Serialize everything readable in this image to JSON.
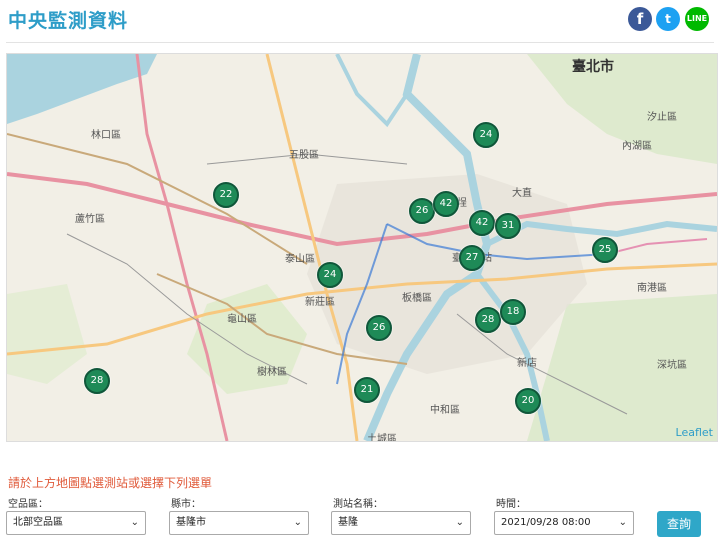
{
  "header": {
    "title": "中央監測資料",
    "social": {
      "facebook": "f",
      "twitter": "t",
      "line": "LINE"
    }
  },
  "map": {
    "attribution": "Leaflet",
    "city_label": "臺北市",
    "markers": [
      "24",
      "22",
      "26",
      "42",
      "42",
      "31",
      "27",
      "25",
      "24",
      "26",
      "28",
      "18",
      "28",
      "21",
      "20"
    ],
    "place_labels": [
      "林口區",
      "蘆竹區",
      "五股區",
      "泰山區",
      "新莊區",
      "龜山區",
      "樹林區",
      "土城區",
      "中和區",
      "南港區",
      "汐止區",
      "內湖區",
      "板橋區",
      "深坑區",
      "大稻埕",
      "大直",
      "臺北車站",
      "新店"
    ]
  },
  "form": {
    "prompt": "請於上方地圖點選測站或選擇下列選單",
    "area_label": "空品區：",
    "area_value": "北部空品區",
    "county_label": "縣市：",
    "county_value": "基隆市",
    "station_label": "測站名稱：",
    "station_value": "基隆",
    "time_label": "時間：",
    "time_value": "2021/09/28 08:00",
    "query_label": "查詢"
  }
}
